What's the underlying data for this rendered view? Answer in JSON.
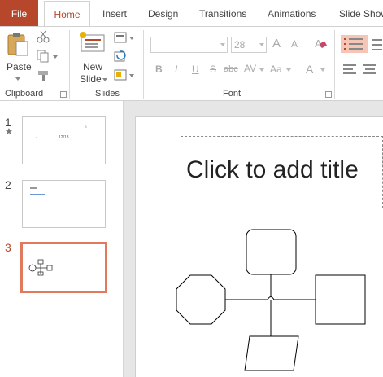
{
  "tabs": {
    "file": "File",
    "home": "Home",
    "insert": "Insert",
    "design": "Design",
    "transitions": "Transitions",
    "animations": "Animations",
    "slideshow": "Slide Show"
  },
  "ribbon": {
    "clipboard": {
      "paste_label": "Paste",
      "group_label": "Clipboard"
    },
    "slides": {
      "new_slide_line1": "New",
      "new_slide_line2": "Slide",
      "group_label": "Slides"
    },
    "font": {
      "size_value": "28",
      "bold": "B",
      "italic": "I",
      "underline": "U",
      "strikethrough": "S",
      "shadow": "abc",
      "spacing": "AV",
      "change_case": "Aa",
      "grow": "A",
      "shrink": "A",
      "font_color": "A",
      "group_label": "Font"
    }
  },
  "slides": [
    {
      "number": "1",
      "star": "★",
      "text_left": "A",
      "text_mid": "12/13",
      "text_right": "B"
    },
    {
      "number": "2",
      "selected": false
    },
    {
      "number": "3",
      "selected": true
    }
  ],
  "editor": {
    "title_placeholder": "Click to add title"
  },
  "colors": {
    "accent": "#b7472a",
    "selected_thumb_border": "#e07a5f"
  }
}
